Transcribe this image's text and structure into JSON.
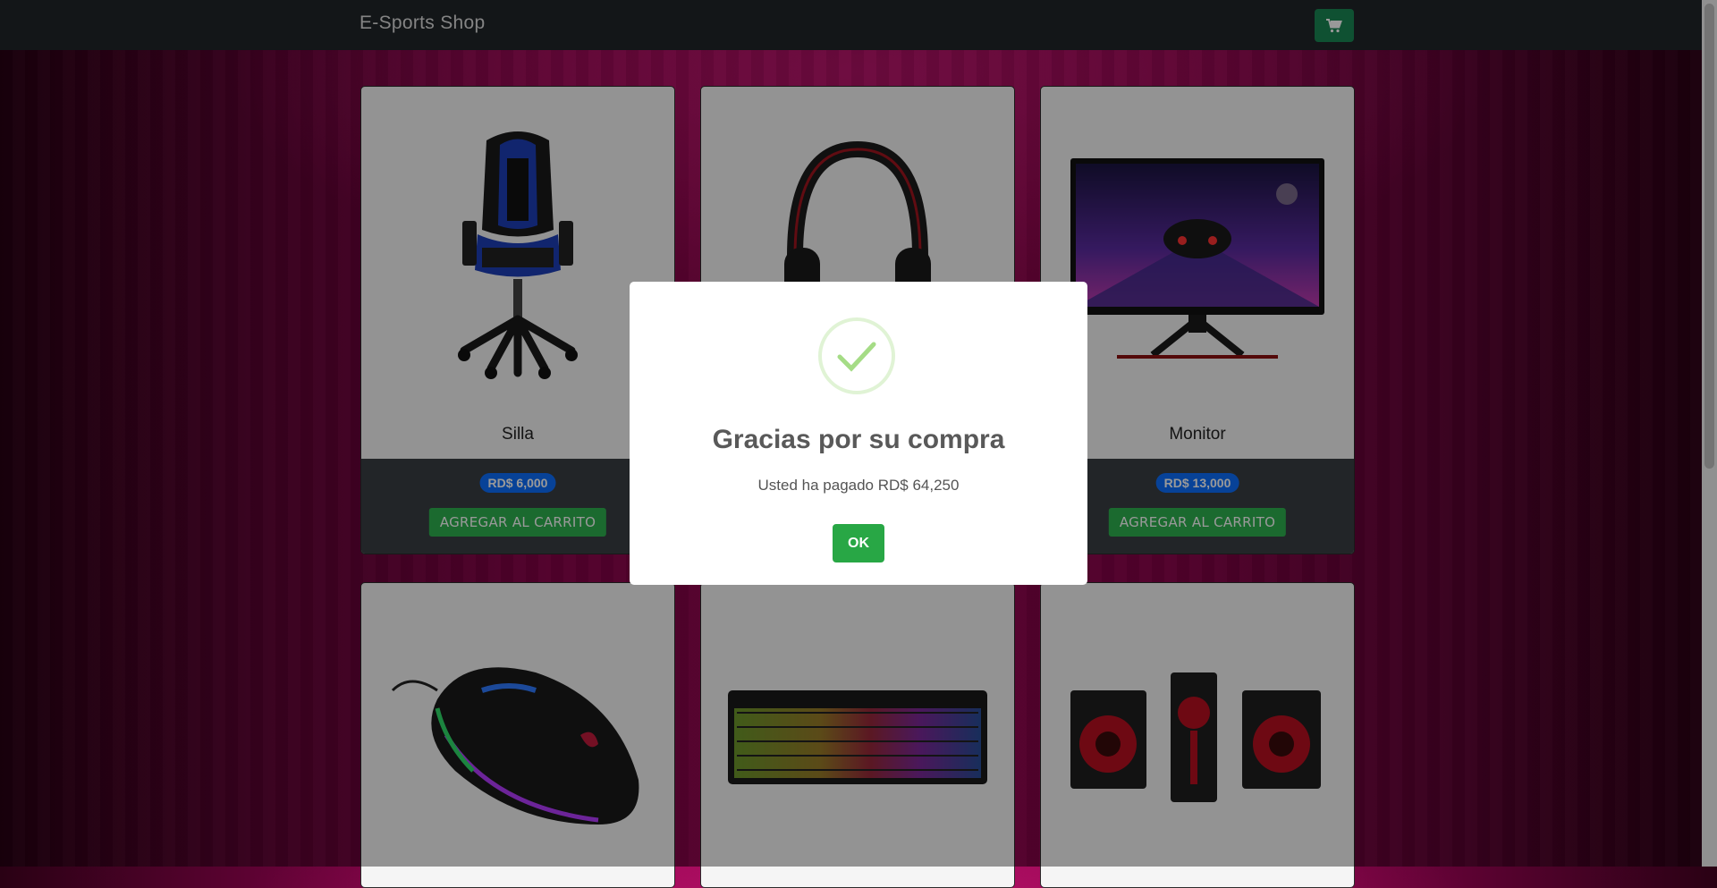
{
  "navbar": {
    "brand": "E-Sports Shop",
    "cart_icon": "shopping-cart-icon",
    "cart_color": "#198754"
  },
  "products": [
    {
      "name": "Silla",
      "price": "RD$ 6,000",
      "button": "AGREGAR AL CARRITO",
      "image": "gaming-chair"
    },
    {
      "name": "",
      "price": "",
      "button": "",
      "image": "gaming-headset"
    },
    {
      "name": "Monitor",
      "price": "RD$ 13,000",
      "button": "AGREGAR AL CARRITO",
      "image": "monitor"
    },
    {
      "name": "",
      "price": "",
      "button": "",
      "image": "gaming-mouse"
    },
    {
      "name": "",
      "price": "",
      "button": "",
      "image": "rgb-keyboard"
    },
    {
      "name": "",
      "price": "",
      "button": "",
      "image": "speakers"
    }
  ],
  "modal": {
    "title": "Gracias por su compra",
    "text": "Usted ha pagado RD$ 64,250",
    "ok_label": "OK",
    "icon": "success-check-icon"
  },
  "colors": {
    "price_badge": "#0d6efd",
    "add_button": "#2db14f",
    "ok_button": "#28a745"
  }
}
